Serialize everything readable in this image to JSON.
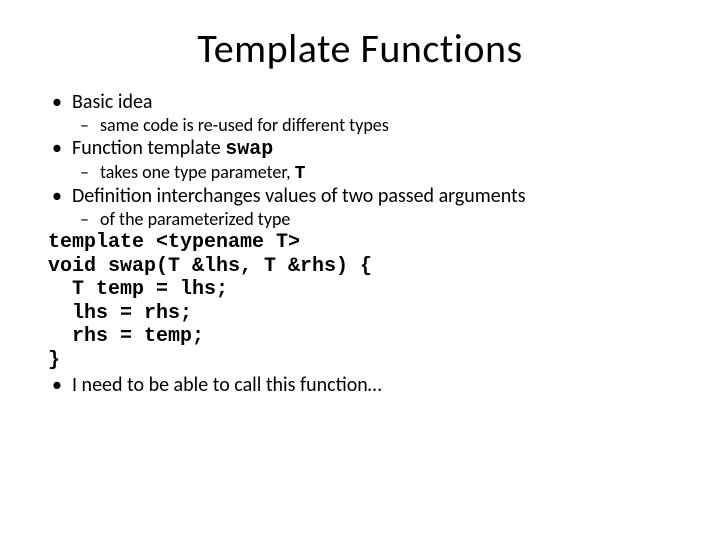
{
  "title": "Template Functions",
  "bullets": {
    "b1": {
      "text": "Basic idea",
      "sub": "same code is re-used for different types"
    },
    "b2": {
      "prefix": "Function template ",
      "code": "swap",
      "sub_prefix": "takes one type parameter, ",
      "sub_code": "T"
    },
    "b3": {
      "text": "Definition interchanges values of two passed arguments",
      "sub": "of the parameterized type"
    },
    "b4": {
      "text": "I need to be able to call this function…"
    }
  },
  "code": {
    "l1": "template <typename T>",
    "l2": "void swap(T &lhs, T &rhs) {",
    "l3": "  T temp = lhs;",
    "l4": "  lhs = rhs;",
    "l5": "  rhs = temp;",
    "l6": "}"
  }
}
